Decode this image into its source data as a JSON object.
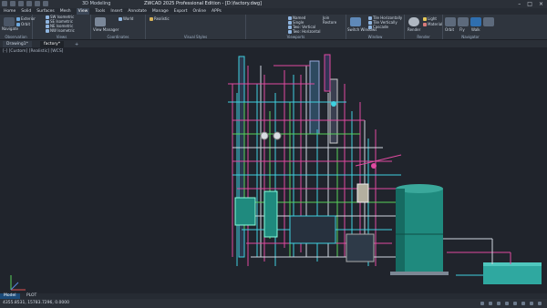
{
  "app": {
    "workspace": "3D Modeling",
    "title": "ZWCAD 2025 Professional Edition - [D:\\factory.dwg]"
  },
  "menu": [
    "Home",
    "Solid",
    "Surfaces",
    "Mesh",
    "View",
    "Tools",
    "Insert",
    "Annotate",
    "Manage",
    "Export",
    "Online",
    "APPs"
  ],
  "menu_active": "View",
  "ribbon": {
    "groups": [
      "Observation",
      "Views",
      "Coordinates",
      "Visual Styles",
      "Viewports",
      "Window",
      "Render",
      "Navigator"
    ],
    "items": {
      "views": [
        "SW Isometric",
        "SE Isometric",
        "NE Isometric",
        "NW Isometric"
      ],
      "views_left": [
        "Exterior",
        "Orbit"
      ],
      "coords": [
        "World",
        "View Manager"
      ],
      "visual": [
        "Realistic"
      ],
      "viewports": [
        "Named",
        "Join",
        "Restore"
      ],
      "viewports2": [
        "Single",
        "Two: Vertical",
        "Two: Horizontal"
      ],
      "window": [
        "Switch Windows",
        "Tile Horizontally",
        "Tile Vertically",
        "Cascade"
      ],
      "render": [
        "Render",
        "Light",
        "Material"
      ],
      "nav": [
        "ViewCube",
        "Fly",
        "Walk",
        "Orbit"
      ],
      "left_big": "Navigate"
    }
  },
  "doc_tabs": [
    "Drawing1*",
    "factory*"
  ],
  "active_doc_tab": "factory*",
  "viewport_label": "[-] [Custom] [Realistic] [WCS]",
  "layout_tabs": [
    "Model",
    "PLOT"
  ],
  "active_layout": "Model",
  "status": {
    "coords": "4355.8531, 15783.7296, 0.0000"
  },
  "colors": {
    "accent": "#1b4a78",
    "tank": "#1f8a7e",
    "pipe_magenta": "#e04aa0",
    "pipe_cyan": "#3fd1e0",
    "pipe_green": "#57d25a"
  }
}
